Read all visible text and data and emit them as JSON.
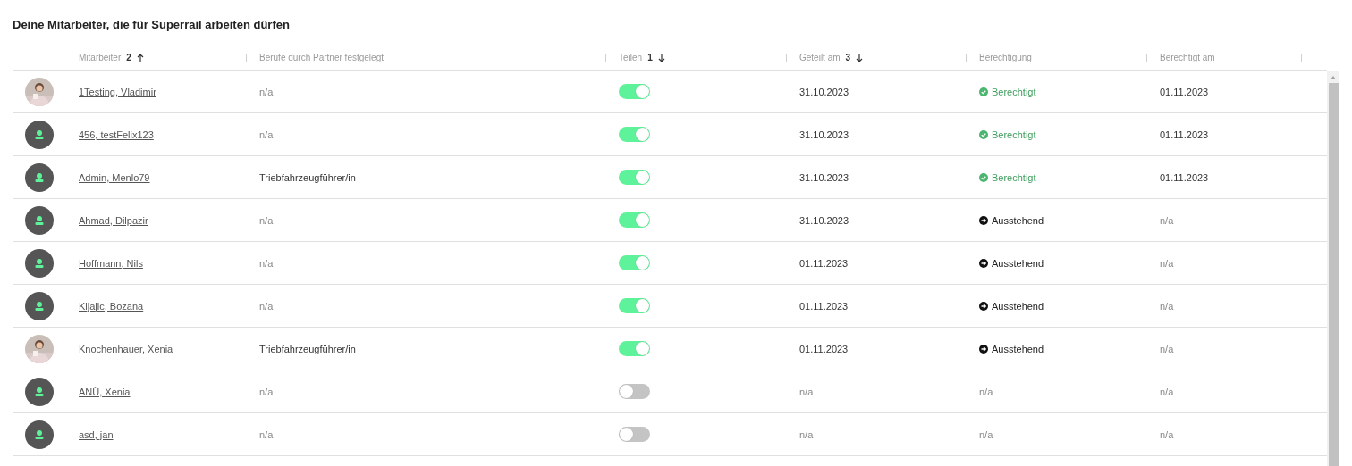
{
  "title": "Deine Mitarbeiter, die für Superrail arbeiten dürfen",
  "columns": [
    {
      "label": "Mitarbeiter",
      "sort": {
        "order": "2",
        "ascending": true
      }
    },
    {
      "label": "Berufe durch Partner festgelegt"
    },
    {
      "label": "Teilen",
      "sort": {
        "order": "1",
        "ascending": false
      }
    },
    {
      "label": "Geteilt am",
      "sort": {
        "order": "3",
        "ascending": false
      }
    },
    {
      "label": "Berechtigung"
    },
    {
      "label": "Berechtigt am"
    }
  ],
  "rows": [
    {
      "name": "1Testing, Vladimir",
      "jobs": "n/a",
      "shared": true,
      "shared_on": "31.10.2023",
      "permission": {
        "kind": "granted",
        "label": "Berechtigt"
      },
      "permitted_on": "01.11.2023"
    },
    {
      "avatar": {
        "kind": "default"
      },
      "name": "456, testFelix123",
      "jobs": "n/a",
      "shared": true,
      "shared_on": "31.10.2023",
      "permission": {
        "kind": "granted",
        "label": "Berechtigt"
      },
      "permitted_on": "01.11.2023"
    },
    {
      "avatar": {
        "kind": "default"
      },
      "name": "Admin, Menlo79",
      "jobs": "Triebfahrzeugführer/in",
      "shared": true,
      "shared_on": "31.10.2023",
      "permission": {
        "kind": "granted",
        "label": "Berechtigt"
      },
      "permitted_on": "01.11.2023"
    },
    {
      "avatar": {
        "kind": "default"
      },
      "name": "Ahmad, Dilpazir",
      "jobs": "n/a",
      "shared": true,
      "shared_on": "31.10.2023",
      "permission": {
        "kind": "pending",
        "label": "Ausstehend"
      },
      "permitted_on": "n/a"
    },
    {
      "avatar": {
        "kind": "default"
      },
      "name": "Hoffmann, Nils",
      "jobs": "n/a",
      "shared": true,
      "shared_on": "01.11.2023",
      "permission": {
        "kind": "pending",
        "label": "Ausstehend"
      },
      "permitted_on": "n/a"
    },
    {
      "avatar": {
        "kind": "default"
      },
      "name": "Kljajic, Bozana",
      "jobs": "n/a",
      "shared": true,
      "shared_on": "01.11.2023",
      "permission": {
        "kind": "pending",
        "label": "Ausstehend"
      },
      "permitted_on": "n/a"
    },
    {
      "name": "Knochenhauer, Xenia",
      "jobs": "Triebfahrzeugführer/in",
      "shared": true,
      "shared_on": "01.11.2023",
      "permission": {
        "kind": "pending",
        "label": "Ausstehend"
      },
      "permitted_on": "n/a"
    },
    {
      "avatar": {
        "kind": "default"
      },
      "name": "ANÜ, Xenia",
      "jobs": "n/a",
      "shared": false,
      "shared_on": "n/a",
      "permission": {
        "kind": "none",
        "label": "n/a"
      },
      "permitted_on": "n/a"
    },
    {
      "avatar": {
        "kind": "default"
      },
      "name": "asd, jan",
      "jobs": "n/a",
      "shared": false,
      "shared_on": "n/a",
      "permission": {
        "kind": "none",
        "label": "n/a"
      },
      "permitted_on": "n/a"
    }
  ]
}
